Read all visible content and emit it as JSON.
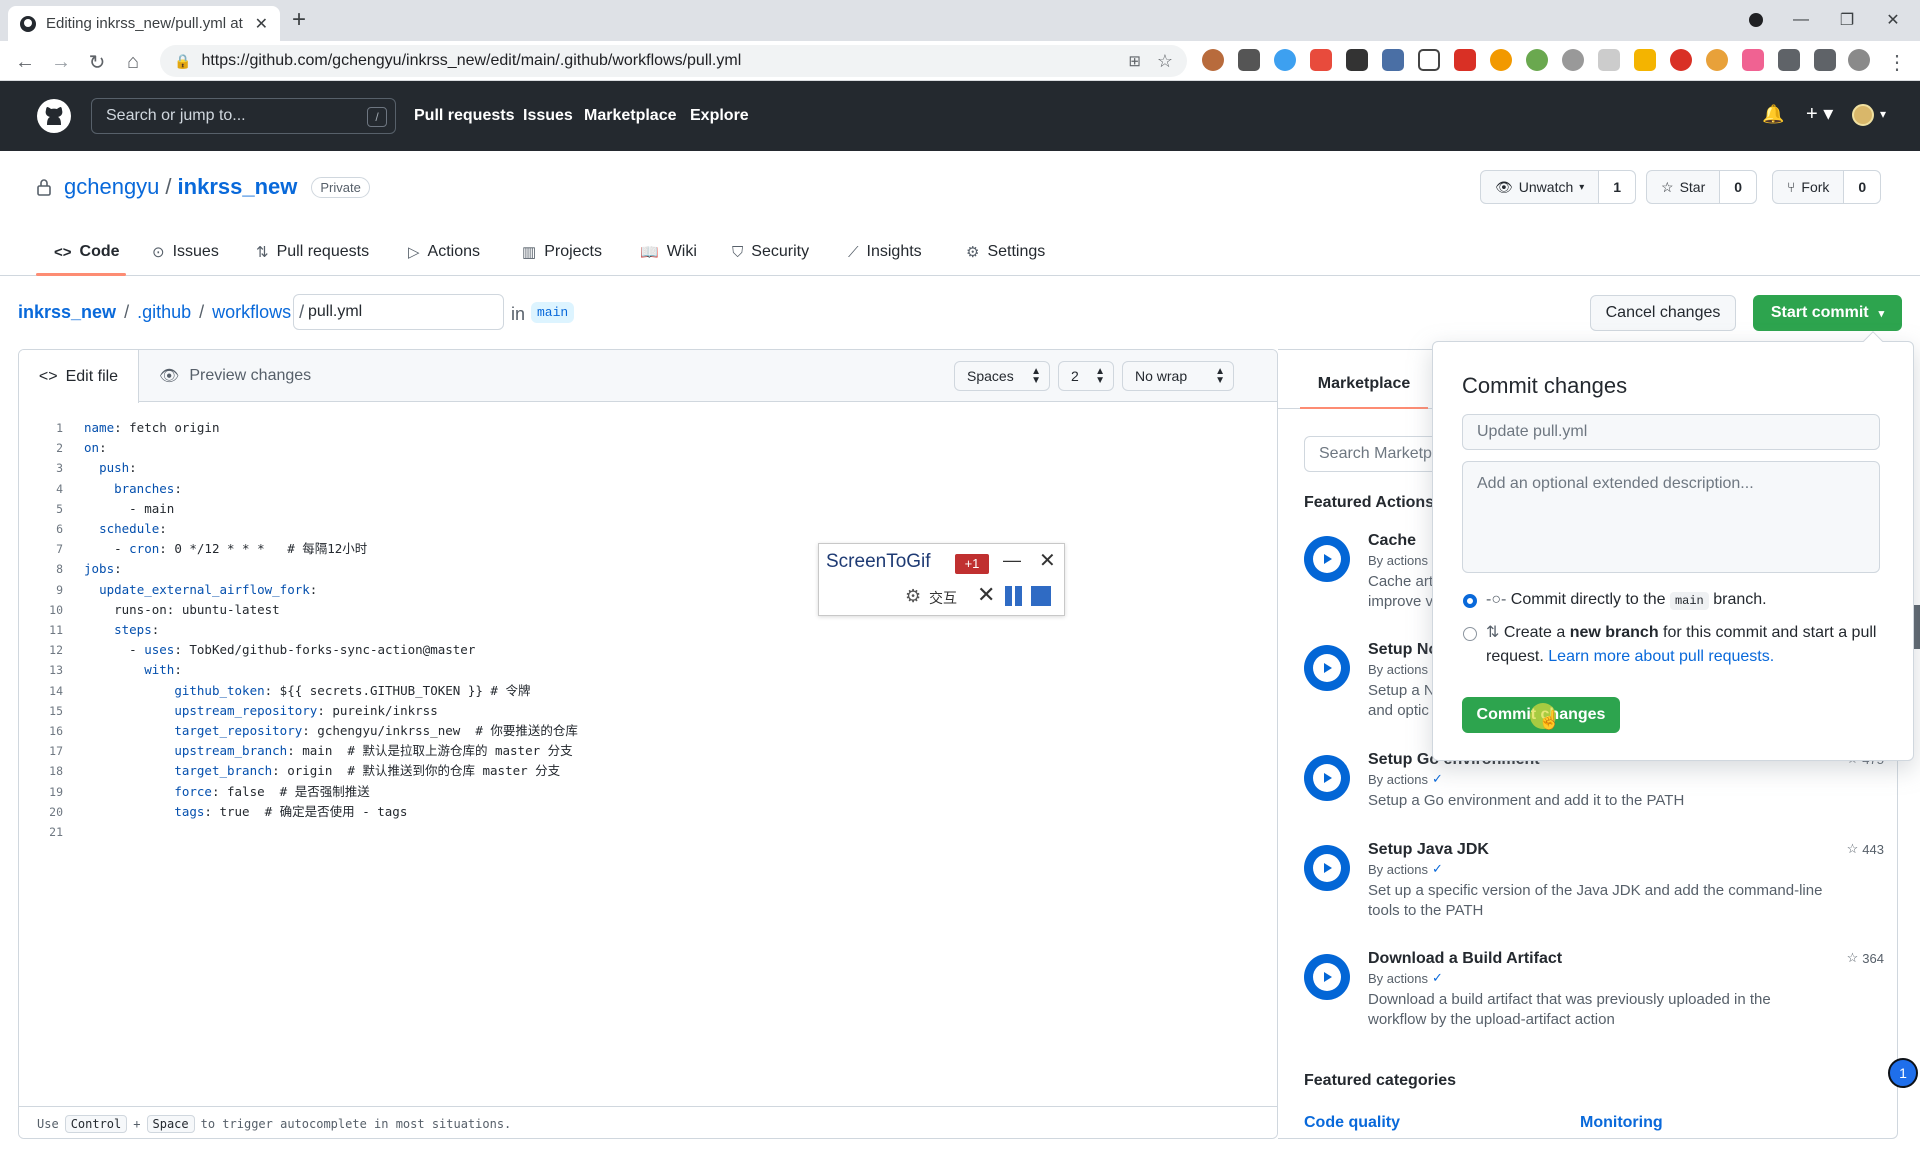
{
  "browser": {
    "tab_title": "Editing inkrss_new/pull.yml at",
    "url": "https://github.com/gchengyu/inkrss_new/edit/main/.github/workflows/pull.yml"
  },
  "header": {
    "search_placeholder": "Search or jump to...",
    "search_shortcut": "/",
    "nav": [
      "Pull requests",
      "Issues",
      "Marketplace",
      "Explore"
    ]
  },
  "repo": {
    "owner": "gchengyu",
    "name": "inkrss_new",
    "visibility": "Private",
    "unwatch_label": "Unwatch",
    "watch_count": "1",
    "star_label": "Star",
    "star_count": "0",
    "fork_label": "Fork",
    "fork_count": "0",
    "tabs": [
      "Code",
      "Issues",
      "Pull requests",
      "Actions",
      "Projects",
      "Wiki",
      "Security",
      "Insights",
      "Settings"
    ]
  },
  "breadcrumb": {
    "root": "inkrss_new",
    "dir1": ".github",
    "dir2": "workflows",
    "filename": "pull.yml",
    "in_label": "in",
    "branch": "main"
  },
  "actions": {
    "cancel": "Cancel changes",
    "start_commit": "Start commit"
  },
  "editor": {
    "tab_edit": "Edit file",
    "tab_preview": "Preview changes",
    "indent_mode": "Spaces",
    "indent_size": "2",
    "wrap_mode": "No wrap",
    "footer_use": "Use",
    "footer_key1": "Control",
    "footer_plus": "+",
    "footer_key2": "Space",
    "footer_hint": "to trigger autocomplete in most situations.",
    "lines": [
      "name: fetch origin",
      "on:",
      "  push:",
      "    branches:",
      "      - main",
      "  schedule:",
      "    - cron: 0 */12 * * *   # 每隔12小时",
      "jobs:",
      "  update_external_airflow_fork:",
      "    runs-on: ubuntu-latest",
      "    steps:",
      "      - uses: TobKed/github-forks-sync-action@master",
      "        with:",
      "            github_token: ${{ secrets.GITHUB_TOKEN }} # 令牌",
      "            upstream_repository: pureink/inkrss",
      "            target_repository: gchengyu/inkrss_new  # 你要推送的仓库",
      "            upstream_branch: main  # 默认是拉取上游仓库的 master 分支",
      "            target_branch: origin  # 默认推送到你的仓库 master 分支",
      "            force: false  # 是否强制推送",
      "            tags: true  # 确定是否使用 - tags",
      ""
    ]
  },
  "screentogif": {
    "title": "ScreenToGif",
    "counter": "+1",
    "interact_label": "交互"
  },
  "marketplace": {
    "tab": "Marketplace",
    "search_placeholder": "Search Marketpl",
    "featured_title": "Featured Actions",
    "items": [
      {
        "name": "Cache",
        "by": "By actions",
        "desc": "Cache art\nimprove v",
        "stars": ""
      },
      {
        "name": "Setup No",
        "by": "By actions",
        "desc": "Setup a N\nand optic",
        "stars": ""
      },
      {
        "name": "Setup Go environment",
        "by": "By actions",
        "desc": "Setup a Go environment and add it to the PATH",
        "stars": "475"
      },
      {
        "name": "Setup Java JDK",
        "by": "By actions",
        "desc": "Set up a specific version of the Java JDK and add the command-line tools to the PATH",
        "stars": "443"
      },
      {
        "name": "Download a Build Artifact",
        "by": "By actions",
        "desc": "Download a build artifact that was previously uploaded in the workflow by the upload-artifact action",
        "stars": "364"
      }
    ],
    "categories_title": "Featured categories",
    "categories": [
      "Code quality",
      "Monitoring"
    ],
    "notif_count": "1"
  },
  "commit_dialog": {
    "title": "Commit changes",
    "summary_placeholder": "Update pull.yml",
    "desc_placeholder": "Add an optional extended description...",
    "opt1_pre": "Commit directly to the",
    "opt1_branch": "main",
    "opt1_post": "branch.",
    "opt2_pre": "Create a",
    "opt2_bold": "new branch",
    "opt2_post": "for this commit and start a pull request.",
    "opt2_link": "Learn more about pull requests.",
    "commit_button": "Commit changes"
  },
  "colors": {
    "primary_green": "#2da44e",
    "link_blue": "#0969da",
    "header_dark": "#24292f",
    "tab_underline": "#fd8c73"
  }
}
